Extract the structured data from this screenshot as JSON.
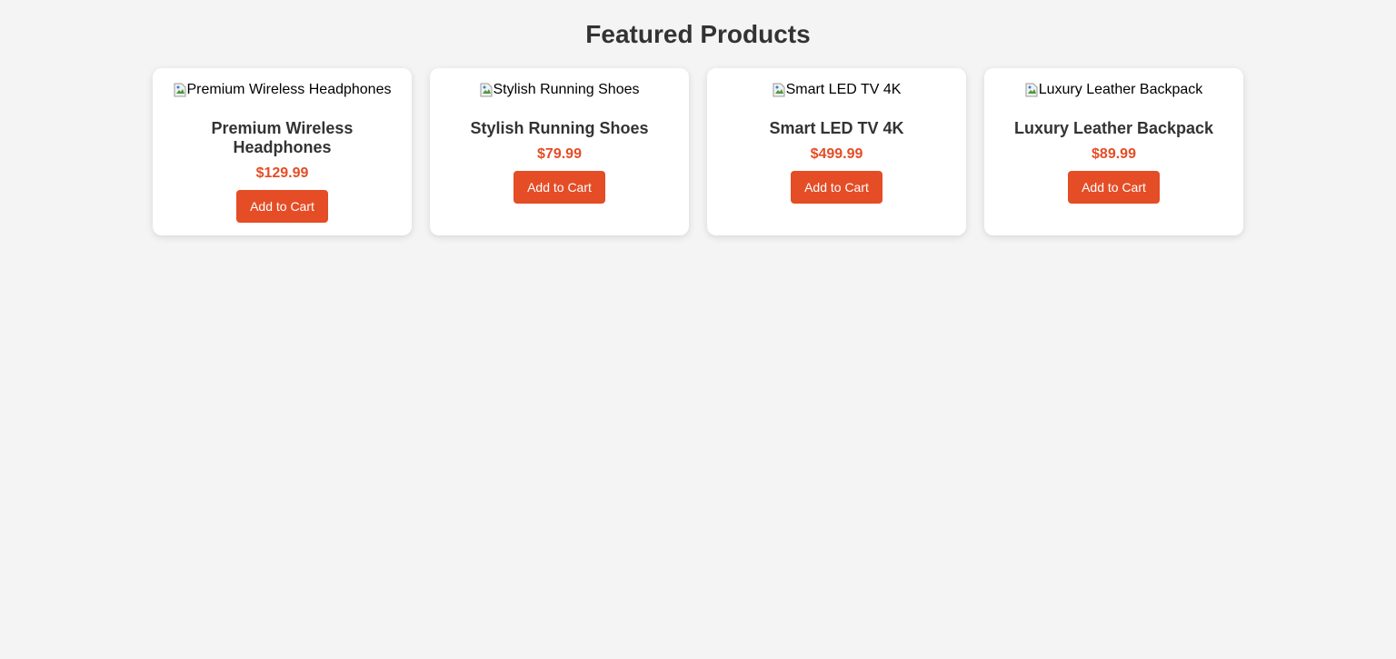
{
  "page": {
    "title": "Featured Products"
  },
  "colors": {
    "accent": "#e44d26",
    "heading": "#333333",
    "background": "#f4f4f4",
    "card": "#ffffff"
  },
  "products": [
    {
      "image_alt": "Premium Wireless Headphones",
      "name": "Premium Wireless Headphones",
      "price": "$129.99",
      "button_label": "Add to Cart"
    },
    {
      "image_alt": "Stylish Running Shoes",
      "name": "Stylish Running Shoes",
      "price": "$79.99",
      "button_label": "Add to Cart"
    },
    {
      "image_alt": "Smart LED TV 4K",
      "name": "Smart LED TV 4K",
      "price": "$499.99",
      "button_label": "Add to Cart"
    },
    {
      "image_alt": "Luxury Leather Backpack",
      "name": "Luxury Leather Backpack",
      "price": "$89.99",
      "button_label": "Add to Cart"
    }
  ]
}
